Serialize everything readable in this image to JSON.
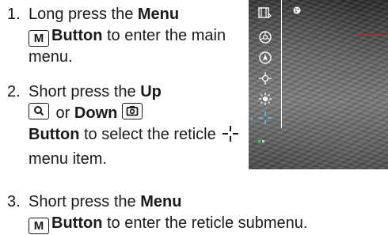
{
  "steps": [
    {
      "number": "1.",
      "t1": "Long press the ",
      "b1": "Menu",
      "key": "M",
      "b2": "Button",
      "t2": " to enter the main menu."
    },
    {
      "number": "2.",
      "t1": "Short press the ",
      "b1": "Up",
      "t2": " or ",
      "b2": "Down",
      "b3": "Button",
      "t3": " to select the reticle ",
      "t4": " menu item."
    },
    {
      "number": "3.",
      "t1": "Short press the ",
      "b1": "Menu",
      "key": "M",
      "b2": "Button",
      "t2": " to enter the reticle submenu."
    }
  ],
  "screen": {
    "icons": [
      "display-mode-icon",
      "color-palette-icon",
      "calibration-icon",
      "zoom-icon",
      "brightness-icon",
      "reticle-icon",
      "wifi-icon"
    ],
    "selected_index": 5,
    "accent_color": "#6ec6ff",
    "reticle_line_color": "#e02020"
  }
}
